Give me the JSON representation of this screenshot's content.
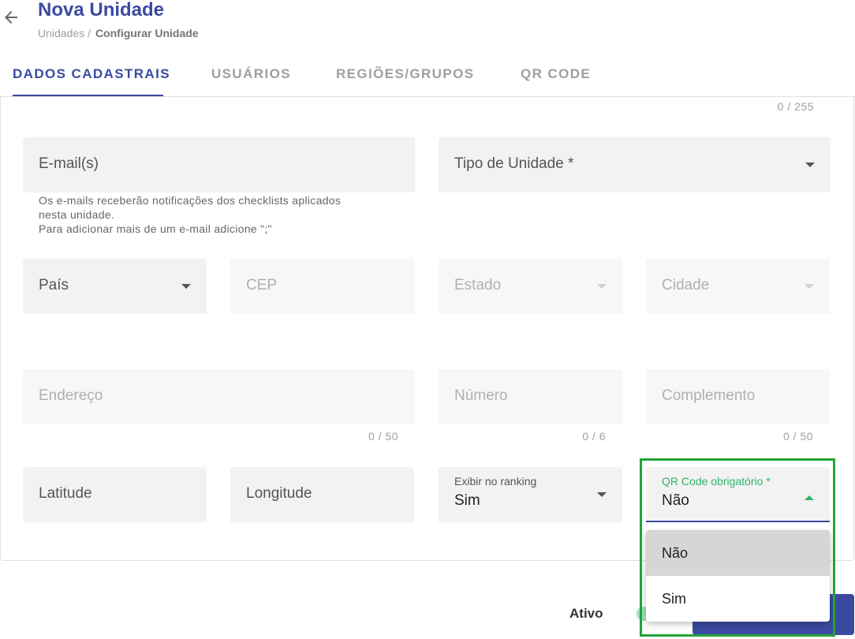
{
  "header": {
    "title": "Nova Unidade",
    "breadcrumb": {
      "parent": "Unidades /",
      "current": "Configurar Unidade"
    }
  },
  "tabs": [
    {
      "label": "DADOS CADASTRAIS",
      "active": true
    },
    {
      "label": "USUÁRIOS",
      "active": false
    },
    {
      "label": "REGIÕES/GRUPOS",
      "active": false
    },
    {
      "label": "QR CODE",
      "active": false
    }
  ],
  "form": {
    "top_counter": "0 / 255",
    "email": {
      "label": "E-mail(s)",
      "hint": [
        "Os e-mails receberão notificações dos checklists aplicados",
        "nesta unidade.",
        "Para adicionar mais de um e-mail adicione \";\""
      ]
    },
    "tipo_unidade": {
      "label": "Tipo de Unidade *"
    },
    "pais": {
      "label": "País"
    },
    "cep": {
      "label": "CEP"
    },
    "estado": {
      "label": "Estado"
    },
    "cidade": {
      "label": "Cidade"
    },
    "endereco": {
      "label": "Endereço",
      "counter": "0 / 50"
    },
    "numero": {
      "label": "Número",
      "counter": "0 / 6"
    },
    "complemento": {
      "label": "Complemento",
      "counter": "0 / 50"
    },
    "latitude": {
      "label": "Latitude"
    },
    "longitude": {
      "label": "Longitude"
    },
    "exibir_ranking": {
      "label": "Exibir no ranking",
      "value": "Sim"
    },
    "qr_obrigatorio": {
      "label": "QR Code obrigatório *",
      "value": "Não",
      "options": [
        "Não",
        "Sim"
      ]
    }
  },
  "footer": {
    "ativo_label": "Ativo"
  },
  "colors": {
    "primary": "#3b4aa0",
    "focus_label": "#2fb36a",
    "highlight_border": "#22a33a",
    "toggle": "#9ee0b8"
  }
}
